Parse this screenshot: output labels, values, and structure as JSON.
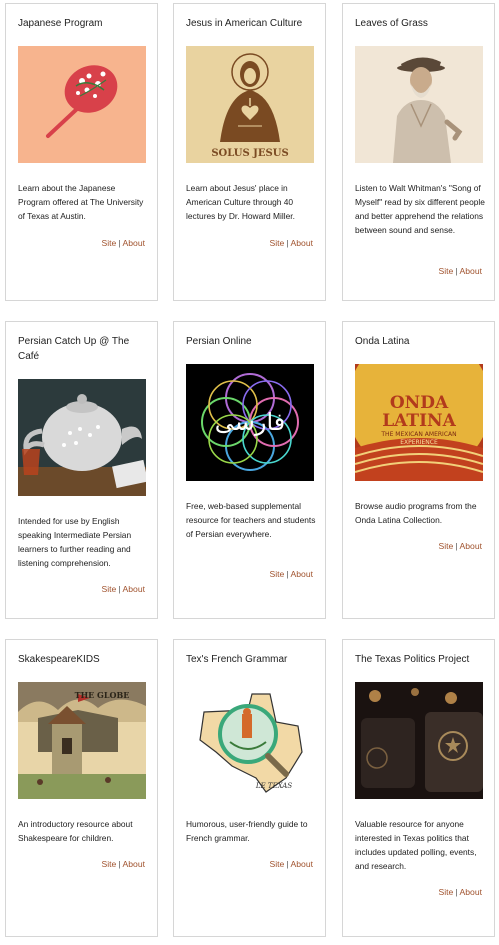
{
  "cards": [
    {
      "title": "Japanese Program",
      "desc": "Learn about the Japanese Program offered at The University of Texas at Austin.",
      "site": "Site",
      "sep": "|",
      "about": "About"
    },
    {
      "title": "Jesus in American Culture",
      "desc": "Learn about Jesus' place in American Culture through 40 lectures by Dr. Howard Miller.",
      "site": "Site",
      "sep": "|",
      "about": "About",
      "image_text": "SOLUS JESUS"
    },
    {
      "title": "Leaves of Grass",
      "desc": "Listen to Walt Whitman's \"Song of Myself\" read by six different people and better apprehend the relations between sound and sense.",
      "site": "Site",
      "sep": "|",
      "about": "About"
    },
    {
      "title": "Persian Catch Up @ The Café",
      "desc": "Intended for use by English speaking Intermediate Persian learners to further reading and listening comprehension.",
      "site": "Site",
      "sep": "|",
      "about": "About"
    },
    {
      "title": "Persian Online",
      "desc": "Free, web-based supplemental resource for teachers and students of Persian everywhere.",
      "site": "Site",
      "sep": "|",
      "about": "About",
      "image_text": "فارسی"
    },
    {
      "title": "Onda Latina",
      "desc": "Browse audio programs from the Onda Latina Collection.",
      "site": "Site",
      "sep": "|",
      "about": "About",
      "image_text_1": "ONDA",
      "image_text_2": "LATINA",
      "image_text_3": "THE MEXICAN AMERICAN",
      "image_text_4": "EXPERIENCE"
    },
    {
      "title": "SkakespeareKIDS",
      "desc": "An introductory resource about Shakespeare for children.",
      "site": "Site",
      "sep": "|",
      "about": "About",
      "image_text": "THE GLOBE"
    },
    {
      "title": "Tex's French Grammar",
      "desc": "Humorous, user-friendly guide to French grammar.",
      "site": "Site",
      "sep": "|",
      "about": "About",
      "image_text": "LE TEXAS"
    },
    {
      "title": "The Texas Politics Project",
      "desc": "Valuable resource for anyone interested in Texas politics that includes updated polling, events, and research.",
      "site": "Site",
      "sep": "|",
      "about": "About"
    }
  ],
  "colors": {
    "link": "#a0522d",
    "border": "#d6d6d6"
  }
}
